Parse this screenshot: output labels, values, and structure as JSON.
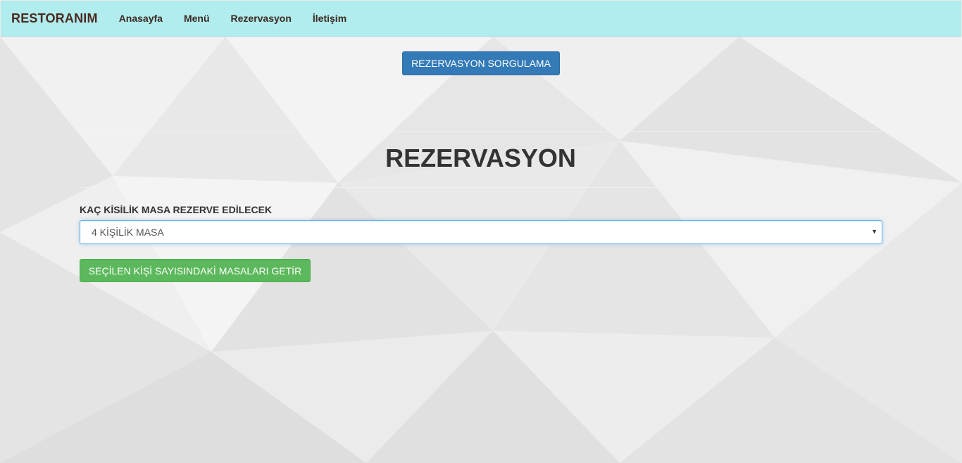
{
  "navbar": {
    "brand": "RESTORANIM",
    "links": [
      "Anasayfa",
      "Menü",
      "Rezervasyon",
      "İletişim"
    ]
  },
  "main": {
    "query_button": "REZERVASYON SORGULAMA",
    "title": "REZERVASYON",
    "select_label": "KAÇ KİSİLİK MASA REZERVE EDİLECEK",
    "select_value": "4 KİŞİLİK MASA",
    "fetch_button": "SEÇİLEN KİŞİ SAYISINDAKİ MASALARI GETİR"
  },
  "colors": {
    "navbar_bg": "#b1ecee",
    "primary": "#337ab7",
    "success": "#5cb85c"
  },
  "icons": {
    "select_caret": "caret-down-icon"
  }
}
